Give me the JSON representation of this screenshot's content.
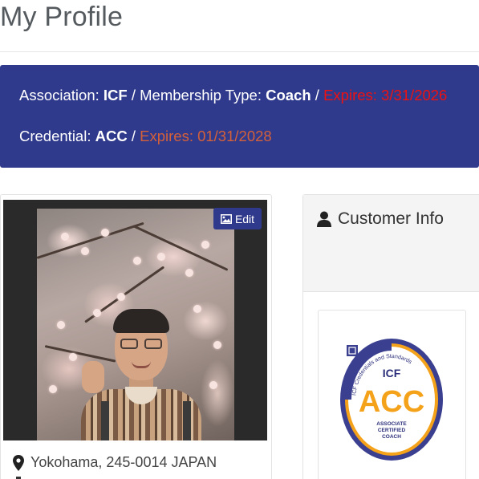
{
  "page": {
    "title": "My Profile"
  },
  "banner": {
    "association_label": "Association:",
    "association_value": "ICF",
    "sep1": "/",
    "membership_label": "Membership Type:",
    "membership_value": "Coach",
    "sep2": "/",
    "membership_expires": "Expires: 3/31/2026",
    "credential_label": "Credential:",
    "credential_value": "ACC",
    "sep3": "/",
    "credential_expires": "Expires: 01/31/2028",
    "colors": {
      "background": "#303a8c",
      "expires_red": "#ee1111",
      "expires_orange": "#d4603a"
    }
  },
  "profile_card": {
    "photo_icon": "image-icon",
    "edit_label": "Edit",
    "location_icon": "map-marker-icon",
    "location": "Yokohama, 245-0014 JAPAN"
  },
  "customer_info": {
    "icon": "user-icon",
    "title": "Customer Info"
  },
  "badge": {
    "logo_text": "ICF",
    "arc_text": "ICF Credentials and Standards",
    "credential": "ACC",
    "line1": "ASSOCIATE",
    "line2": "CERTIFIED",
    "line3": "COACH",
    "colors": {
      "ring": "#3b3f8f",
      "accent": "#f5a21b",
      "text": "#2b2f7a"
    }
  }
}
